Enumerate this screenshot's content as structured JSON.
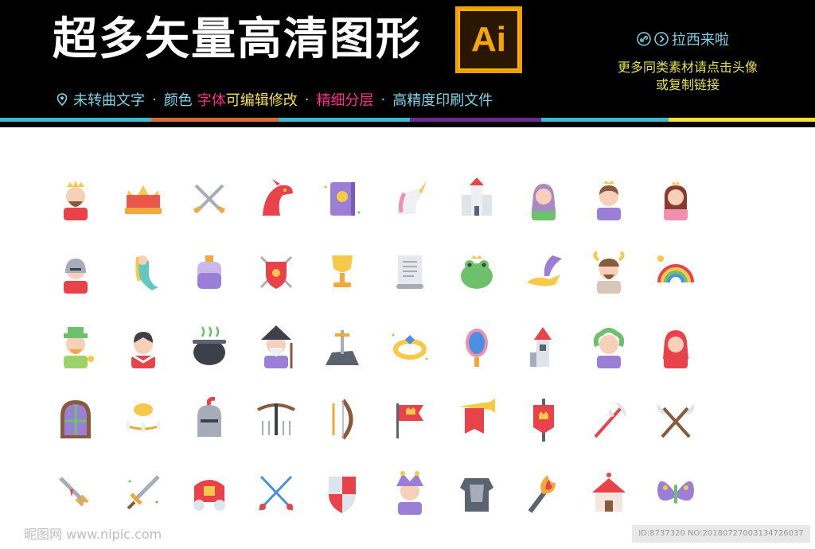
{
  "banner": {
    "title": "超多矢量高清图形",
    "ai_badge": "Ai",
    "features": [
      {
        "text": "未转曲文字",
        "color": "#7fd3e8"
      },
      {
        "text": "颜色",
        "color": "#7fd3e8"
      },
      {
        "text": "字体",
        "color": "#ff2d8e"
      },
      {
        "text": "可编辑修改",
        "color": "#f5e04a"
      },
      {
        "text": "精细分层",
        "color": "#ff2d8e"
      },
      {
        "text": "高精度印刷文件",
        "color": "#7fd3e8"
      }
    ],
    "separator": "·",
    "brand": "拉西来啦",
    "promo_line1": "更多同类素材请点击头像",
    "promo_line2": "或复制链接"
  },
  "icons": [
    [
      "king-icon",
      "crown-icon",
      "crossed-swords-icon",
      "dragon-icon",
      "spell-book-icon",
      "unicorn-icon",
      "castle-icon",
      "elf-icon",
      "princess-icon",
      "queen-icon"
    ],
    [
      "knight-icon",
      "mermaid-icon",
      "potion-icon",
      "shield-swords-icon",
      "goblet-icon",
      "scroll-icon",
      "frog-prince-icon",
      "magic-lamp-icon",
      "faun-icon",
      "rainbow-icon"
    ],
    [
      "leprechaun-icon",
      "vampire-icon",
      "cauldron-icon",
      "wizard-icon",
      "sword-in-stone-icon",
      "magic-ring-icon",
      "magic-mirror-icon",
      "tower-icon",
      "medusa-icon",
      "red-riding-hood-icon"
    ],
    [
      "stained-window-icon",
      "chandelier-icon",
      "helmet-icon",
      "crossbow-icon",
      "bow-icon",
      "flag-icon",
      "trumpet-banner-icon",
      "banner-icon",
      "battle-axe-icon",
      "crossed-axes-icon"
    ],
    [
      "bloody-dagger-icon",
      "magic-sword-icon",
      "carriage-icon",
      "crossed-rapiers-icon",
      "heraldic-shield-icon",
      "jester-icon",
      "armor-icon",
      "torch-icon",
      "gingerbread-house-icon",
      "fairy-wings-icon"
    ]
  ],
  "footer": {
    "watermark": "昵图网 www.nipic.com",
    "image_id": "ID:8737320 NO:20180727003134726037"
  },
  "colors": {
    "banner_bg": "#000000",
    "accent_cyan": "#7fd3e8",
    "accent_yellow": "#e6e04a",
    "ai_orange": "#f7a600"
  }
}
